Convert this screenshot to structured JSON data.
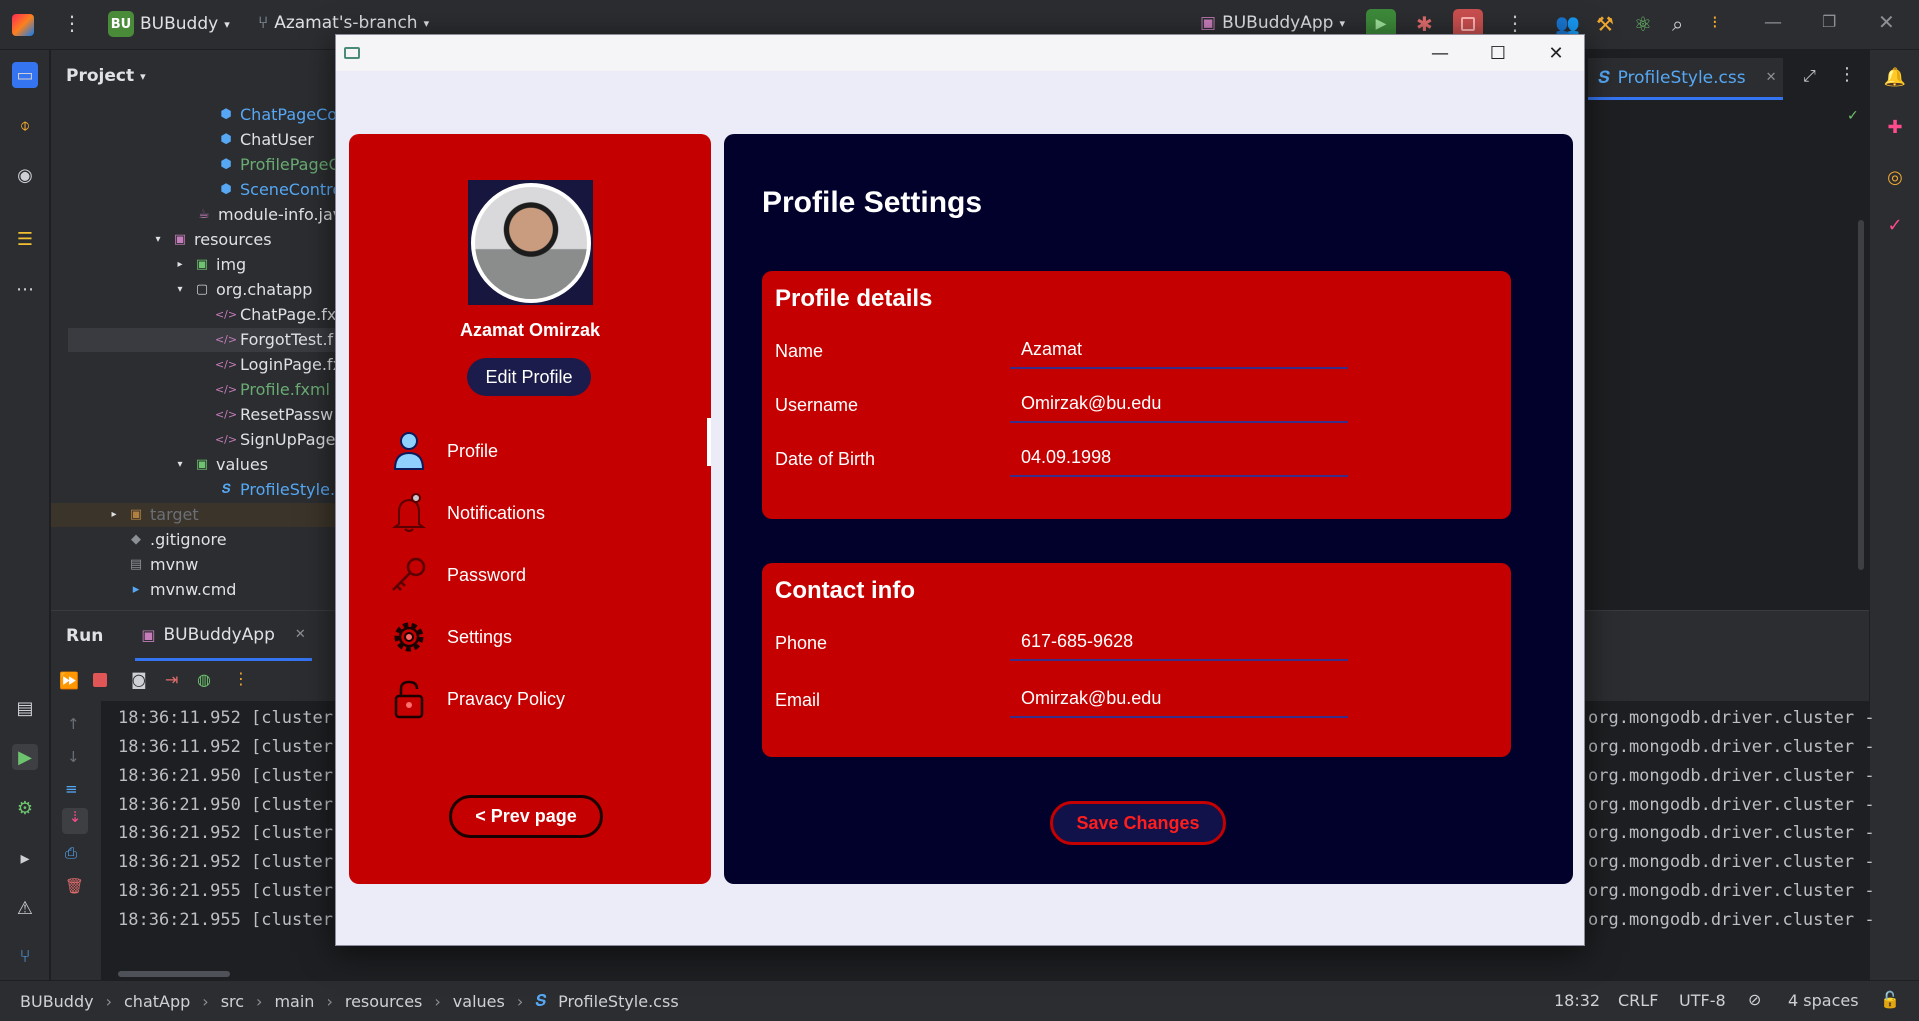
{
  "ide": {
    "project_badge": "BU",
    "project_name": "BUBuddy",
    "branch": "Azamat's-branch",
    "run_config": "BUBuddyApp",
    "project_panel_title": "Project",
    "editor_tab": "ProfileStyle.css"
  },
  "tree": [
    {
      "label": "ChatPageCo",
      "kind": "class",
      "color": "blue"
    },
    {
      "label": "ChatUser",
      "kind": "class",
      "color": "normal"
    },
    {
      "label": "ProfilePageC",
      "kind": "class",
      "color": "green"
    },
    {
      "label": "SceneContro",
      "kind": "class",
      "color": "blue"
    },
    {
      "label": "module-info.jav",
      "kind": "java",
      "color": "normal"
    },
    {
      "label": "resources",
      "kind": "folder",
      "color": "normal"
    },
    {
      "label": "img",
      "kind": "folder",
      "color": "normal"
    },
    {
      "label": "org.chatapp",
      "kind": "folder",
      "color": "normal"
    },
    {
      "label": "ChatPage.fx",
      "kind": "fxml",
      "color": "normal"
    },
    {
      "label": "ForgotTest.f",
      "kind": "fxml",
      "color": "normal"
    },
    {
      "label": "LoginPage.fx",
      "kind": "fxml",
      "color": "normal"
    },
    {
      "label": "Profile.fxml",
      "kind": "fxml",
      "color": "green"
    },
    {
      "label": "ResetPassw",
      "kind": "fxml",
      "color": "normal"
    },
    {
      "label": "SignUpPage",
      "kind": "fxml",
      "color": "normal"
    },
    {
      "label": "values",
      "kind": "folder",
      "color": "normal"
    },
    {
      "label": "ProfileStyle.c",
      "kind": "css",
      "color": "blue"
    },
    {
      "label": "target",
      "kind": "folder",
      "color": "dim"
    },
    {
      "label": ".gitignore",
      "kind": "file",
      "color": "normal"
    },
    {
      "label": "mvnw",
      "kind": "file",
      "color": "normal"
    },
    {
      "label": "mvnw.cmd",
      "kind": "file",
      "color": "normal"
    }
  ],
  "run": {
    "tab_run": "Run",
    "tab_app": "BUBuddyApp",
    "logs": [
      {
        "time": "18:36:11.952 [cluster-",
        "tail": "org.mongodb.driver.cluster -"
      },
      {
        "time": "18:36:11.952 [cluster-",
        "tail": "org.mongodb.driver.cluster -"
      },
      {
        "time": "18:36:21.950 [cluster-",
        "tail": "org.mongodb.driver.cluster -"
      },
      {
        "time": "18:36:21.950 [cluster-",
        "tail": "org.mongodb.driver.cluster -"
      },
      {
        "time": "18:36:21.952 [cluster-",
        "tail": "org.mongodb.driver.cluster -"
      },
      {
        "time": "18:36:21.952 [cluster-",
        "tail": "org.mongodb.driver.cluster -"
      },
      {
        "time": "18:36:21.955 [cluster-",
        "tail": "org.mongodb.driver.cluster -"
      },
      {
        "time": "18:36:21.955 [cluster-",
        "tail": "org.mongodb.driver.cluster -"
      }
    ]
  },
  "statusbar": {
    "crumbs": [
      "BUBuddy",
      "chatApp",
      "src",
      "main",
      "resources",
      "values",
      "ProfileStyle.css"
    ],
    "position": "18:32",
    "line_sep": "CRLF",
    "encoding": "UTF-8",
    "indent": "4 spaces"
  },
  "app": {
    "user_name": "Azamat Omirzak",
    "edit_profile": "Edit Profile",
    "menu": [
      {
        "label": "Profile",
        "icon": "user-icon"
      },
      {
        "label": "Notifications",
        "icon": "bell-icon"
      },
      {
        "label": "Password",
        "icon": "key-icon"
      },
      {
        "label": "Settings",
        "icon": "gear-icon"
      },
      {
        "label": "Pravacy Policy",
        "icon": "lock-icon"
      }
    ],
    "prev_page": "< Prev page",
    "title": "Profile Settings",
    "profile_details": {
      "heading": "Profile details",
      "fields": [
        {
          "label": "Name",
          "value": "Azamat"
        },
        {
          "label": "Username",
          "value": "Omirzak@bu.edu"
        },
        {
          "label": "Date of Birth",
          "value": "04.09.1998"
        }
      ]
    },
    "contact_info": {
      "heading": "Contact info",
      "fields": [
        {
          "label": "Phone",
          "value": "617-685-9628"
        },
        {
          "label": "Email",
          "value": "Omirzak@bu.edu"
        }
      ]
    },
    "save_changes": "Save Changes"
  },
  "colors": {
    "left_card": "#c40000",
    "right_card": "#02012b",
    "dialog_bg": "#ececf8"
  }
}
